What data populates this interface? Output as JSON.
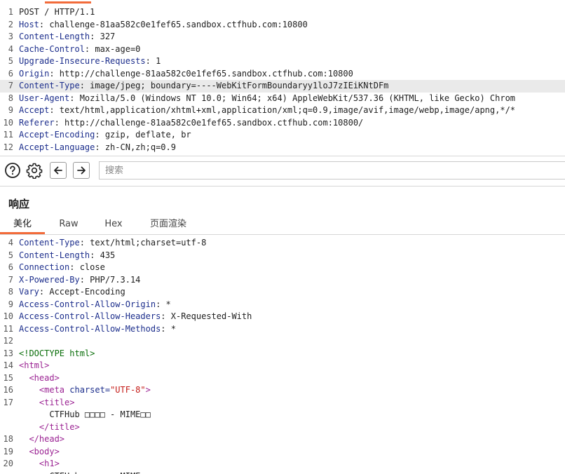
{
  "request": {
    "lines": [
      {
        "n": "1",
        "parts": [
          {
            "c": "plain",
            "t": "POST / HTTP/1.1"
          }
        ]
      },
      {
        "n": "2",
        "parts": [
          {
            "c": "hname",
            "t": "Host"
          },
          {
            "c": "hval",
            "t": ": challenge-81aa582c0e1fef65.sandbox.ctfhub.com:10800"
          }
        ]
      },
      {
        "n": "3",
        "parts": [
          {
            "c": "hname",
            "t": "Content-Length"
          },
          {
            "c": "hval",
            "t": ": 327"
          }
        ]
      },
      {
        "n": "4",
        "parts": [
          {
            "c": "hname",
            "t": "Cache-Control"
          },
          {
            "c": "hval",
            "t": ": max-age=0"
          }
        ]
      },
      {
        "n": "5",
        "parts": [
          {
            "c": "hname",
            "t": "Upgrade-Insecure-Requests"
          },
          {
            "c": "hval",
            "t": ": 1"
          }
        ]
      },
      {
        "n": "6",
        "parts": [
          {
            "c": "hname",
            "t": "Origin"
          },
          {
            "c": "hval",
            "t": ": http://challenge-81aa582c0e1fef65.sandbox.ctfhub.com:10800"
          }
        ]
      },
      {
        "n": "7",
        "hl": true,
        "parts": [
          {
            "c": "hname",
            "t": "Content-Type"
          },
          {
            "c": "hval",
            "t": ": image/jpeg; boundary=----WebKitFormBoundaryy1loJ7zIEiKNtDFm"
          }
        ]
      },
      {
        "n": "8",
        "parts": [
          {
            "c": "hname",
            "t": "User-Agent"
          },
          {
            "c": "hval",
            "t": ": Mozilla/5.0 (Windows NT 10.0; Win64; x64) AppleWebKit/537.36 (KHTML, like Gecko) Chrom"
          }
        ]
      },
      {
        "n": "9",
        "parts": [
          {
            "c": "hname",
            "t": "Accept"
          },
          {
            "c": "hval",
            "t": ": text/html,application/xhtml+xml,application/xml;q=0.9,image/avif,image/webp,image/apng,*/*"
          }
        ]
      },
      {
        "n": "10",
        "parts": [
          {
            "c": "hname",
            "t": "Referer"
          },
          {
            "c": "hval",
            "t": ": http://challenge-81aa582c0e1fef65.sandbox.ctfhub.com:10800/"
          }
        ]
      },
      {
        "n": "11",
        "parts": [
          {
            "c": "hname",
            "t": "Accept-Encoding"
          },
          {
            "c": "hval",
            "t": ": gzip, deflate, br"
          }
        ]
      },
      {
        "n": "12",
        "parts": [
          {
            "c": "hname",
            "t": "Accept-Language"
          },
          {
            "c": "hval",
            "t": ": zh-CN,zh;q=0.9"
          }
        ]
      }
    ]
  },
  "toolbar": {
    "help_icon": "question-circle-icon",
    "settings_icon": "gear-icon",
    "back_icon": "arrow-left-icon",
    "forward_icon": "arrow-right-icon",
    "search_placeholder": "搜索"
  },
  "response": {
    "title": "响应",
    "tabs": [
      {
        "label": "美化",
        "active": true
      },
      {
        "label": "Raw",
        "active": false
      },
      {
        "label": "Hex",
        "active": false
      },
      {
        "label": "页面渲染",
        "active": false
      }
    ],
    "lines": [
      {
        "n": "4",
        "parts": [
          {
            "c": "hname",
            "t": "Content-Type"
          },
          {
            "c": "hval",
            "t": ": text/html;charset=utf-8"
          }
        ]
      },
      {
        "n": "5",
        "parts": [
          {
            "c": "hname",
            "t": "Content-Length"
          },
          {
            "c": "hval",
            "t": ": 435"
          }
        ]
      },
      {
        "n": "6",
        "parts": [
          {
            "c": "hname",
            "t": "Connection"
          },
          {
            "c": "hval",
            "t": ": close"
          }
        ]
      },
      {
        "n": "7",
        "parts": [
          {
            "c": "hname",
            "t": "X-Powered-By"
          },
          {
            "c": "hval",
            "t": ": PHP/7.3.14"
          }
        ]
      },
      {
        "n": "8",
        "parts": [
          {
            "c": "hname",
            "t": "Vary"
          },
          {
            "c": "hval",
            "t": ": Accept-Encoding"
          }
        ]
      },
      {
        "n": "9",
        "parts": [
          {
            "c": "hname",
            "t": "Access-Control-Allow-Origin"
          },
          {
            "c": "hval",
            "t": ": *"
          }
        ]
      },
      {
        "n": "10",
        "parts": [
          {
            "c": "hname",
            "t": "Access-Control-Allow-Headers"
          },
          {
            "c": "hval",
            "t": ": X-Requested-With"
          }
        ]
      },
      {
        "n": "11",
        "parts": [
          {
            "c": "hname",
            "t": "Access-Control-Allow-Methods"
          },
          {
            "c": "hval",
            "t": ": *"
          }
        ]
      },
      {
        "n": "12",
        "parts": []
      },
      {
        "n": "13",
        "parts": [
          {
            "c": "doctype",
            "t": "<!DOCTYPE html>"
          }
        ]
      },
      {
        "n": "14",
        "parts": [
          {
            "c": "tag",
            "t": "<html>"
          }
        ]
      },
      {
        "n": "15",
        "parts": [
          {
            "c": "plain",
            "t": "  "
          },
          {
            "c": "tag",
            "t": "<head>"
          }
        ]
      },
      {
        "n": "16",
        "parts": [
          {
            "c": "plain",
            "t": "    "
          },
          {
            "c": "tag",
            "t": "<meta "
          },
          {
            "c": "attr",
            "t": "charset="
          },
          {
            "c": "aval",
            "t": "\"UTF-8\""
          },
          {
            "c": "tag",
            "t": ">"
          }
        ]
      },
      {
        "n": "17",
        "parts": [
          {
            "c": "plain",
            "t": "    "
          },
          {
            "c": "tag",
            "t": "<title>"
          }
        ]
      },
      {
        "n": "",
        "parts": [
          {
            "c": "plain",
            "t": "      CTFHub □□□□ - MIME□□"
          }
        ]
      },
      {
        "n": "",
        "parts": [
          {
            "c": "plain",
            "t": "    "
          },
          {
            "c": "tag",
            "t": "</title>"
          }
        ]
      },
      {
        "n": "18",
        "parts": [
          {
            "c": "plain",
            "t": "  "
          },
          {
            "c": "tag",
            "t": "</head>"
          }
        ]
      },
      {
        "n": "19",
        "parts": [
          {
            "c": "plain",
            "t": "  "
          },
          {
            "c": "tag",
            "t": "<body>"
          }
        ]
      },
      {
        "n": "20",
        "parts": [
          {
            "c": "plain",
            "t": "    "
          },
          {
            "c": "tag",
            "t": "<h1>"
          }
        ]
      },
      {
        "n": "",
        "parts": [
          {
            "c": "plain",
            "t": "      CTFHub □□□□ - MIME□□"
          }
        ]
      }
    ]
  },
  "colors": {
    "accent": "#f26b3a",
    "header_name": "#1c2e8c",
    "tag": "#9b2393",
    "attr_value": "#c41a16",
    "doctype": "#0a6e0a"
  }
}
